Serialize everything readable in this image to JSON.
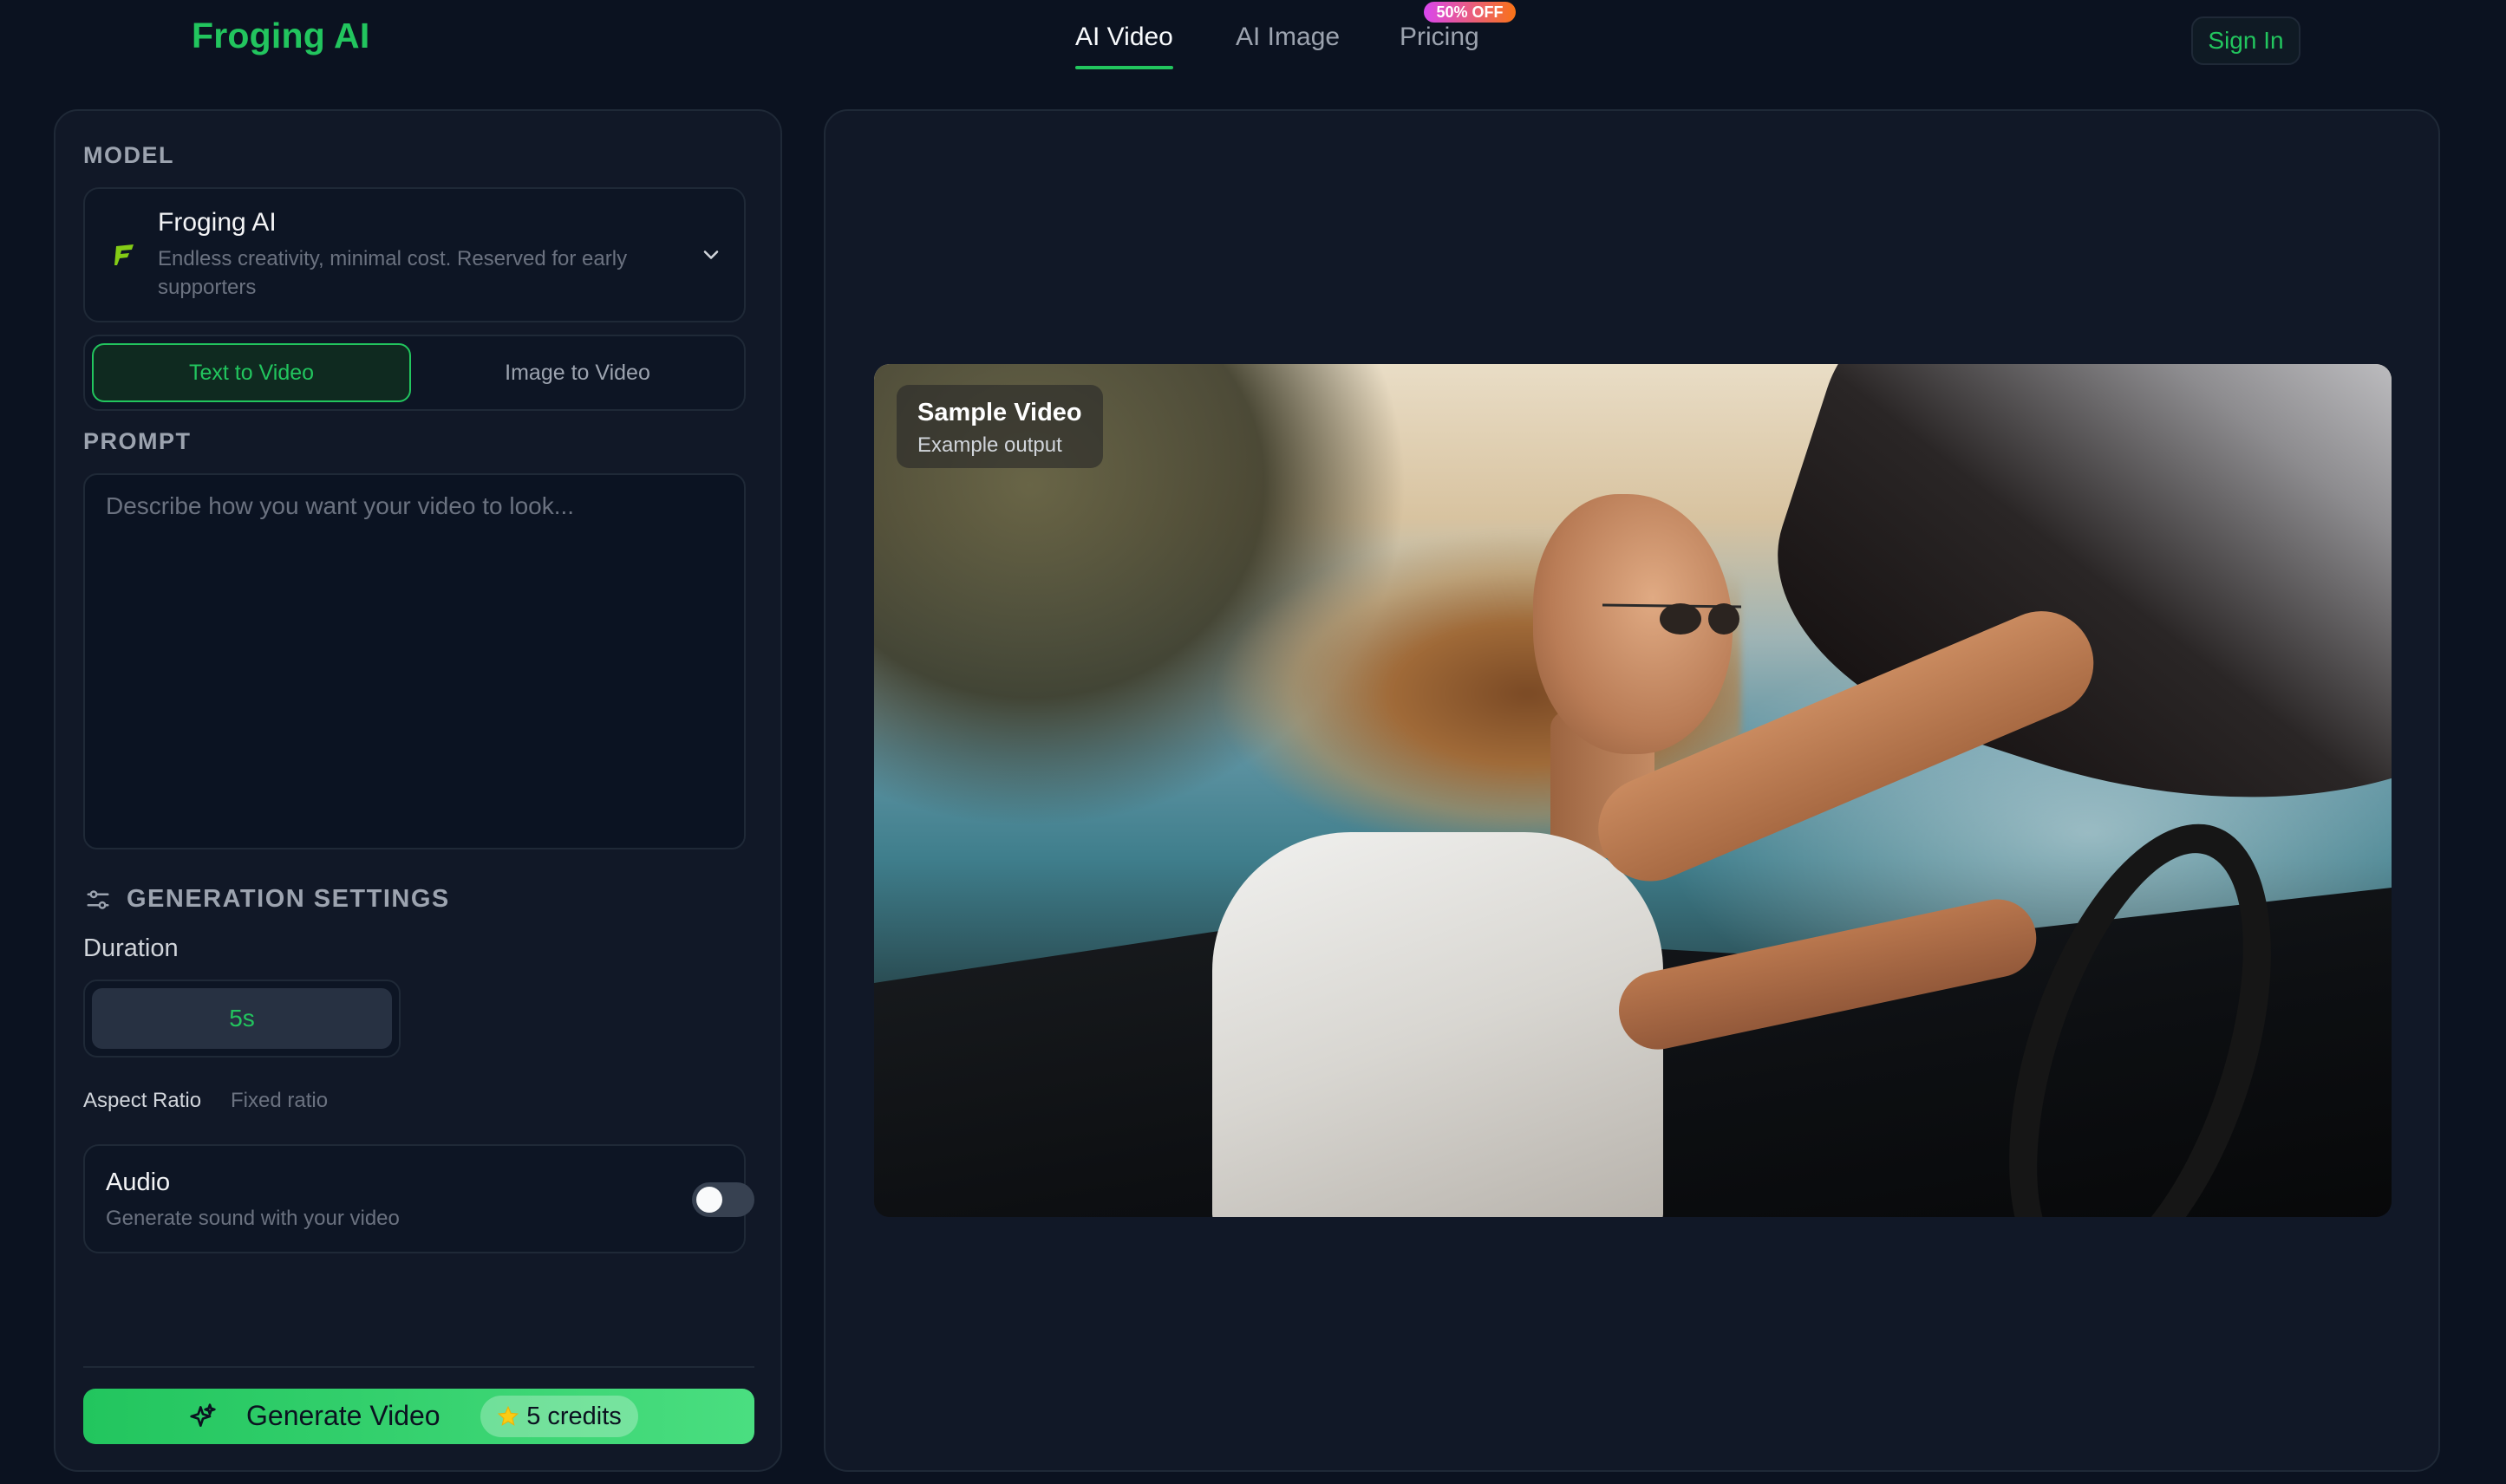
{
  "brand": {
    "name": "Froging AI"
  },
  "nav": {
    "items": [
      {
        "label": "AI Video",
        "active": true
      },
      {
        "label": "AI Image",
        "active": false
      },
      {
        "label": "Pricing",
        "active": false
      }
    ],
    "pricing_badge": "50% OFF",
    "sign_in": "Sign In"
  },
  "left": {
    "model_section_label": "MODEL",
    "model": {
      "name": "Froging AI",
      "description": "Endless creativity, minimal cost. Reserved for early supporters",
      "icon": "froging-logo-icon"
    },
    "mode_tabs": [
      {
        "label": "Text to Video",
        "active": true
      },
      {
        "label": "Image to Video",
        "active": false
      }
    ],
    "prompt_section_label": "PROMPT",
    "prompt": {
      "value": "",
      "placeholder": "Describe how you want your video to look..."
    },
    "settings_label": "GENERATION SETTINGS",
    "duration_label": "Duration",
    "duration_options": [
      "5s"
    ],
    "duration_selected": "5s",
    "aspect_ratio_label": "Aspect Ratio",
    "aspect_ratio_value": "Fixed ratio",
    "audio": {
      "title": "Audio",
      "description": "Generate sound with your video",
      "enabled": false
    },
    "generate": {
      "label": "Generate Video",
      "credits": "5 credits"
    }
  },
  "preview": {
    "tag_title": "Sample Video",
    "tag_subtitle": "Example output"
  },
  "colors": {
    "accent": "#22c55e",
    "background": "#0b1220",
    "panel": "#111827",
    "badge_gradient_start": "#d946ef",
    "badge_gradient_end": "#f97316"
  }
}
